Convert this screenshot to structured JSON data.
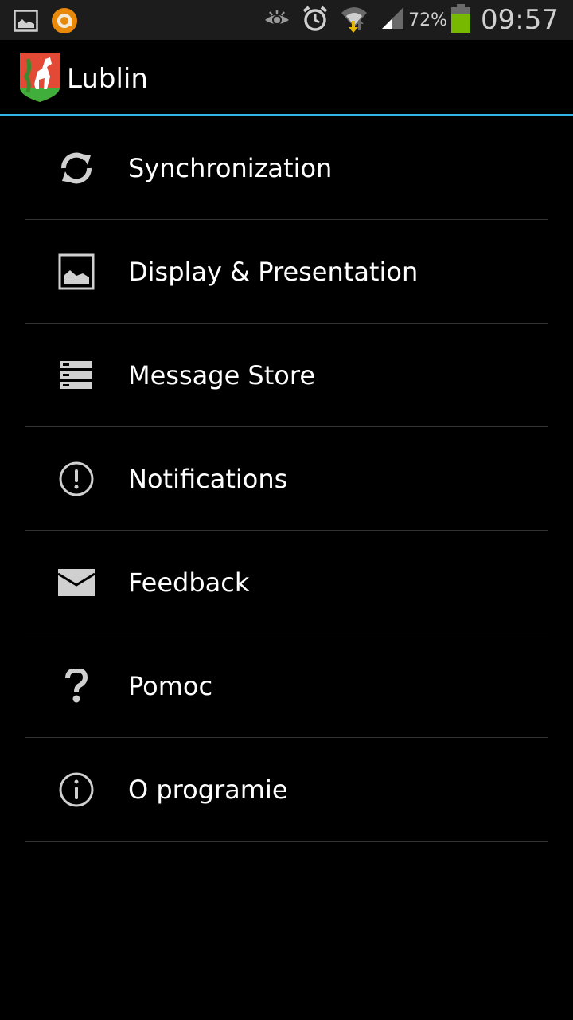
{
  "status_bar": {
    "battery_percent": "72%",
    "time": "09:57",
    "left_icons": [
      "gallery-notification-icon",
      "app-notification-icon"
    ],
    "right_icons": [
      "smart-stay-eye-icon",
      "alarm-icon",
      "wifi-icon",
      "signal-icon",
      "battery-icon"
    ],
    "battery_color": "#76b900"
  },
  "action_bar": {
    "title": "Lublin",
    "accent_color": "#33b5e5"
  },
  "menu": {
    "items": [
      {
        "label": "Synchronization",
        "icon": "sync-icon"
      },
      {
        "label": "Display & Presentation",
        "icon": "image-icon"
      },
      {
        "label": "Message Store",
        "icon": "storage-icon"
      },
      {
        "label": "Notifications",
        "icon": "alert-icon"
      },
      {
        "label": "Feedback",
        "icon": "mail-icon"
      },
      {
        "label": "Pomoc",
        "icon": "help-icon"
      },
      {
        "label": "O programie",
        "icon": "info-icon"
      }
    ]
  }
}
